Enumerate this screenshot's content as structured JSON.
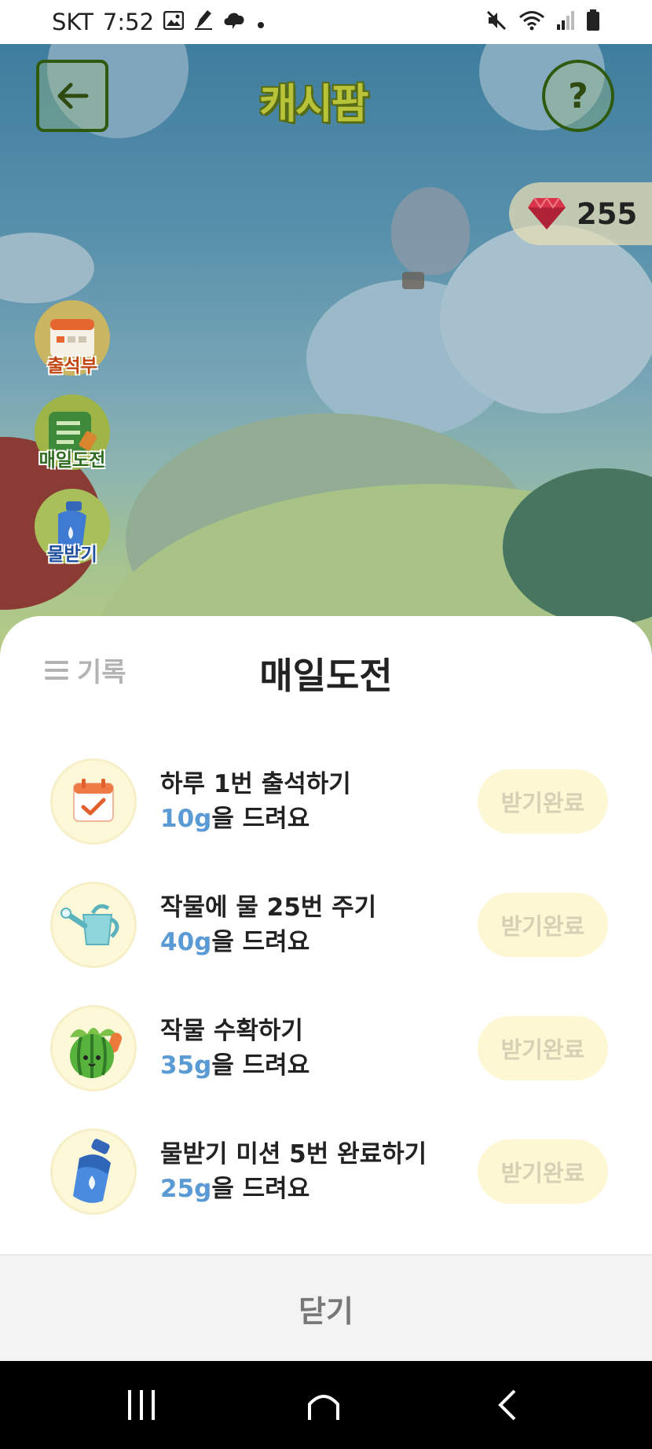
{
  "status_bar": {
    "carrier": "SKT",
    "time": "7:52",
    "icons_left": [
      "gallery-icon",
      "pen-icon",
      "cloud-icon",
      "dot-icon"
    ],
    "icons_right": [
      "mute-icon",
      "wifi-icon",
      "signal-icon",
      "battery-icon"
    ]
  },
  "game": {
    "logo_text": "캐시팜",
    "gem_count": "255",
    "help_label": "?",
    "side_menu": [
      {
        "label": "출석부",
        "icon": "calendar-icon"
      },
      {
        "label": "매일도전",
        "icon": "checklist-icon"
      },
      {
        "label": "물받기",
        "icon": "water-bottle-icon"
      }
    ]
  },
  "sheet": {
    "history_label": "기록",
    "title": "매일도전",
    "missions": [
      {
        "title": "하루 1번 출석하기",
        "amount": "10g",
        "suffix": "을 드려요",
        "button": "받기완료",
        "icon": "calendar-check-icon"
      },
      {
        "title": "작물에 물 25번 주기",
        "amount": "40g",
        "suffix": "을 드려요",
        "button": "받기완료",
        "icon": "watering-can-icon"
      },
      {
        "title": "작물 수확하기",
        "amount": "35g",
        "suffix": "을 드려요",
        "button": "받기완료",
        "icon": "watermelon-icon"
      },
      {
        "title": "물받기 미션 5번 완료하기",
        "amount": "25g",
        "suffix": "을 드려요",
        "button": "받기완료",
        "icon": "water-bottle-icon"
      }
    ],
    "close_label": "닫기"
  },
  "colors": {
    "amount_blue": "#5b9bd5",
    "button_bg": "#fdf7d4",
    "button_text": "#d6d0b4",
    "icon_bg": "#fdf8d8"
  }
}
